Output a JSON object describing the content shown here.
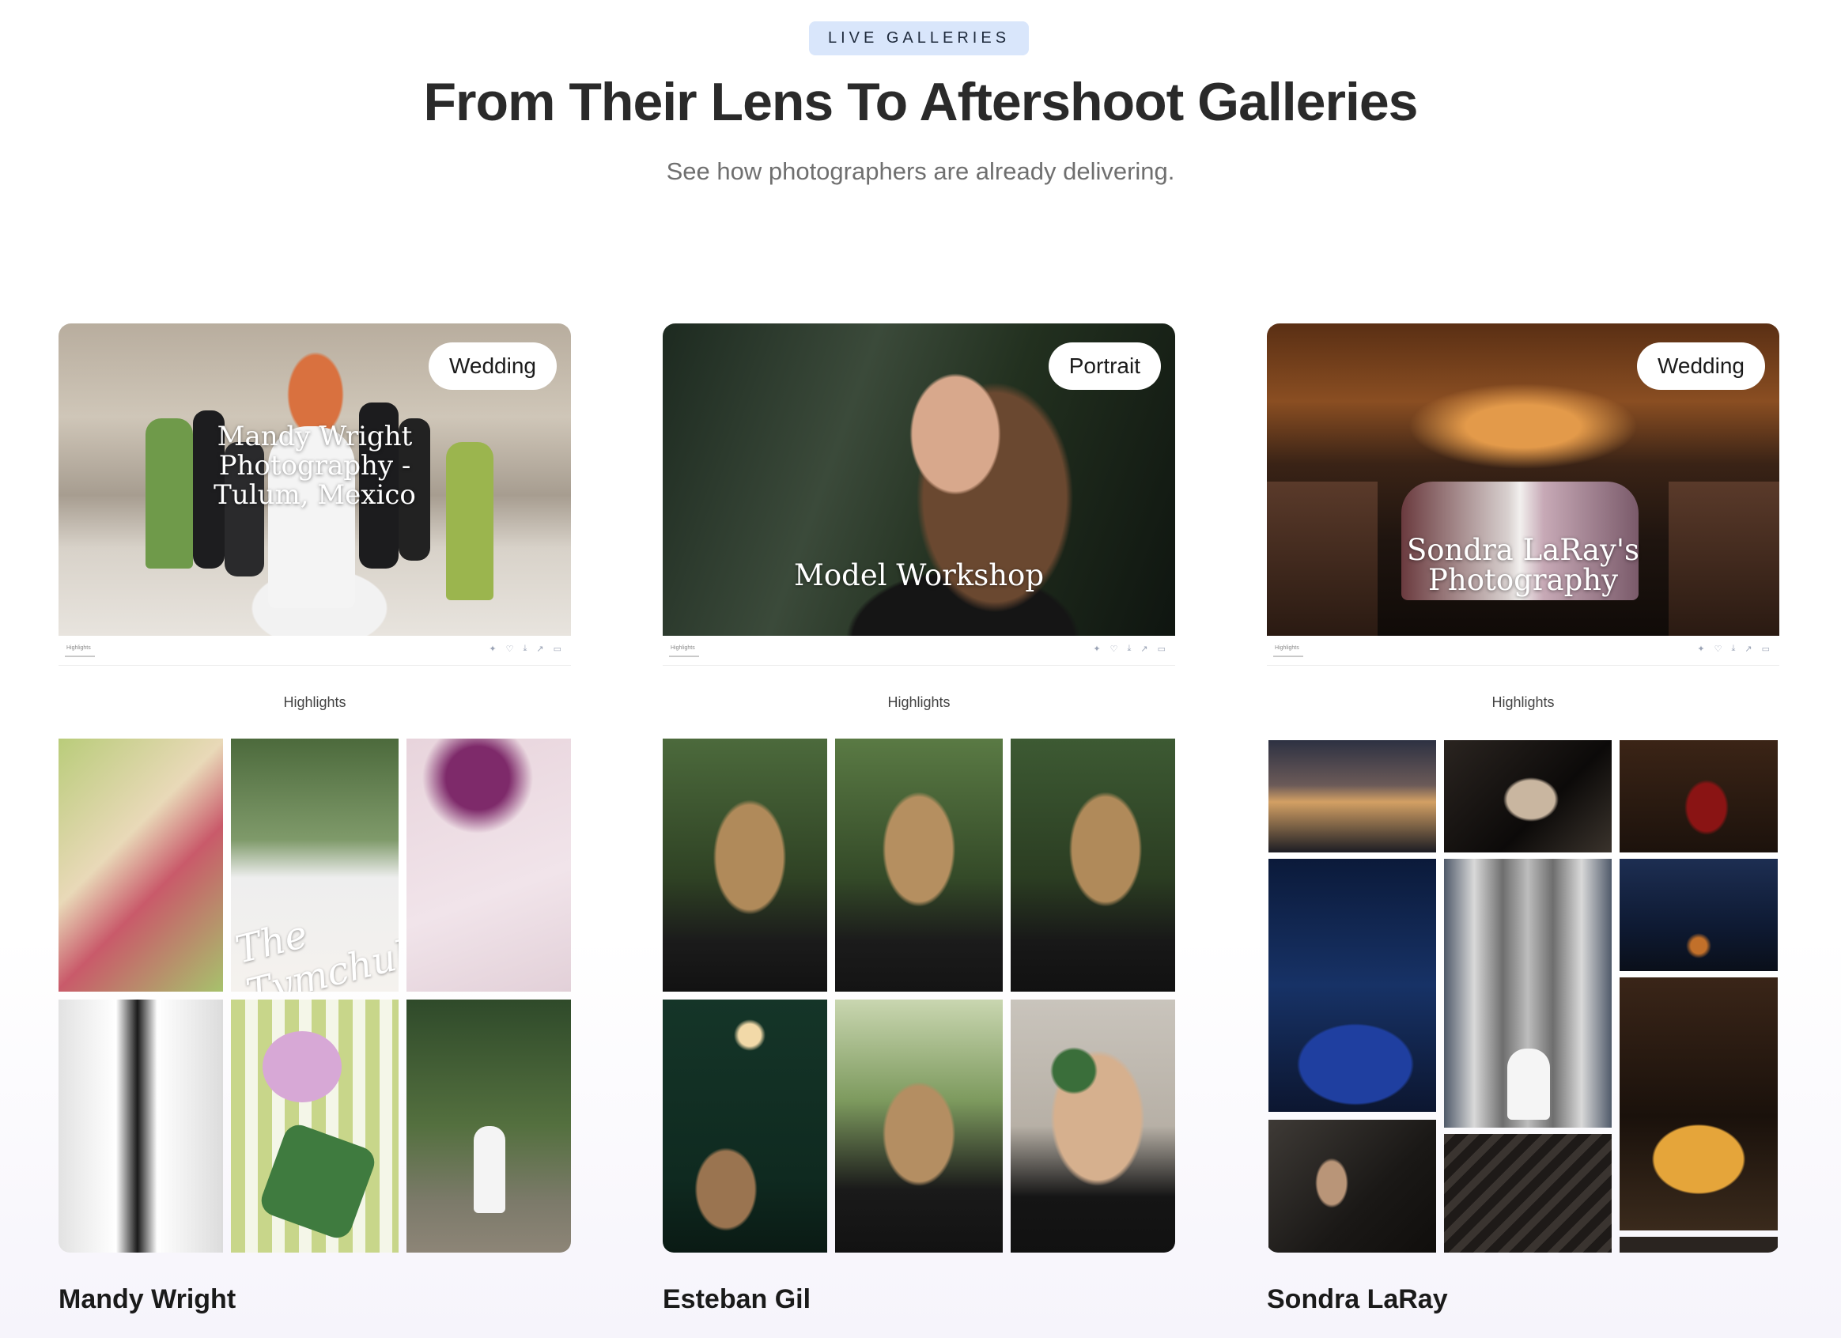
{
  "header": {
    "badge": "LIVE GALLERIES",
    "title": "From Their Lens To Aftershoot Galleries",
    "subtitle": "See how photographers are already delivering."
  },
  "cards": [
    {
      "tag": "Wedding",
      "hero_title": "Mandy Wright Photography - Tulum, Mexico",
      "toolbar_label": "Highlights",
      "section_label": "Highlights",
      "grid_text": "The Tymchuks",
      "name": "Mandy Wright"
    },
    {
      "tag": "Portrait",
      "hero_title": "Model Workshop",
      "toolbar_label": "Highlights",
      "section_label": "Highlights",
      "name": "Esteban Gil"
    },
    {
      "tag": "Wedding",
      "hero_title": "Sondra LaRay's Photography",
      "toolbar_label": "Highlights",
      "section_label": "Highlights",
      "name": "Sondra LaRay"
    }
  ],
  "toolbar_icons": [
    "pin-icon",
    "heart-icon",
    "download-icon",
    "share-icon",
    "chat-icon"
  ],
  "colors": {
    "badge_bg": "#d9e6fb",
    "title": "#2a2a2a",
    "subtitle": "#6f6f6f"
  }
}
